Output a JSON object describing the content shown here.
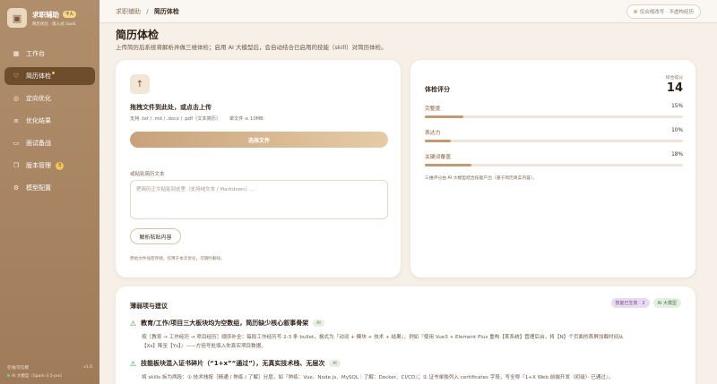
{
  "brand": {
    "title": "求职辅助",
    "badge": "个人",
    "subtitle": "简历优化 · 嵌入式 SaaS",
    "logo_icon": "briefcase-icon"
  },
  "sidebar": {
    "items": [
      {
        "label": "工作台",
        "icon": "grid-icon",
        "glyph": "▦",
        "active": false
      },
      {
        "label": "简历体检",
        "icon": "stethoscope-icon",
        "glyph": "♡",
        "active": true
      },
      {
        "label": "定向优化",
        "icon": "target-icon",
        "glyph": "◎",
        "active": false
      },
      {
        "label": "优化结果",
        "icon": "list-icon",
        "glyph": "≡",
        "active": false
      },
      {
        "label": "面试备战",
        "icon": "chat-icon",
        "glyph": "▭",
        "active": false
      },
      {
        "label": "版本管理",
        "icon": "layers-icon",
        "glyph": "❐",
        "active": false,
        "badge": "3"
      },
      {
        "label": "模型配置",
        "icon": "gear-icon",
        "glyph": "⚙",
        "active": false
      }
    ],
    "footer": {
      "left": "在线/可信模",
      "right": "v1.0",
      "model_status": "AI 大模型（Spark-3.5-pro）"
    }
  },
  "topbar": {
    "breadcrumb_root": "求职辅助",
    "breadcrumb_sep": "/",
    "breadcrumb_current": "简历体检",
    "pill": "仅合规改写 · 不虚构经历"
  },
  "page": {
    "title": "简历体检",
    "description": "上传简历后系统将解析并做三维体检；启用 AI 大模型后，会自动结合已启用的技能（skill）对简历体检。"
  },
  "upload": {
    "icon": "upload-icon",
    "title": "拖拽文件到此处，或点击上传",
    "hint_types": "支持 .txt / .md / .docx / .pdf（文本简历）",
    "hint_size": "单文件 ≤ 10MB",
    "choose_button": "选择文件",
    "paste_label": "或粘贴简历文本",
    "paste_placeholder": "把简历正文粘贴到这里（支持纯文本 / Markdown）...",
    "parse_button": "解析粘贴内容",
    "note": "原始文件加密存储，仅用于本次优化，可随时删除。"
  },
  "score": {
    "title": "体检评分",
    "overall_label": "综合得分",
    "overall_value": "14",
    "metrics": [
      {
        "name": "完整度",
        "value": 15,
        "display": "15%"
      },
      {
        "name": "表达力",
        "value": 10,
        "display": "10%"
      },
      {
        "name": "关键词覆盖",
        "value": 18,
        "display": "18%"
      }
    ],
    "note": "三维评分由 AI 大模型结合技能产出（基于简历真实内容）。"
  },
  "weak": {
    "title": "薄弱项与建议",
    "tag_skills": "技能已生效 · 2",
    "tag_ai": "AI 大模型",
    "issues": [
      {
        "title": "教育/工作/项目三大板块均为空数组，简历缺少核心叙事骨架",
        "chip": "AI",
        "body_line1": "按［教育 → 工作经历 → 项目经历］顺序补全：每段工作经历写 2-3 条 bullet，格式为『动词 + 模块 + 技术 + 结果』，例如『使用 Vue3 + Element Plus 重构【某系统】管理后台，将【N】个页面的首屏加载时间从",
        "body_line2": "【Xs】降至【Ys】』——方括号处填入你真实项目数据。"
      },
      {
        "title": "技能板块混入证书碎片（“1+x”“通过”），无真实技术栈、无层次",
        "chip": "AI",
        "body_line1": "将 skills 拆为两段：① 技术栈按［精通 / 熟练 / 了解］分层，如『熟练：Vue、Node.js、MySQL｜了解：Docker、CI/CD』；② 证书单独列入 certificates 字段，写全称『1+X Web 前端开发（初级）· 已通过』，",
        "body_line2": ""
      }
    ]
  }
}
